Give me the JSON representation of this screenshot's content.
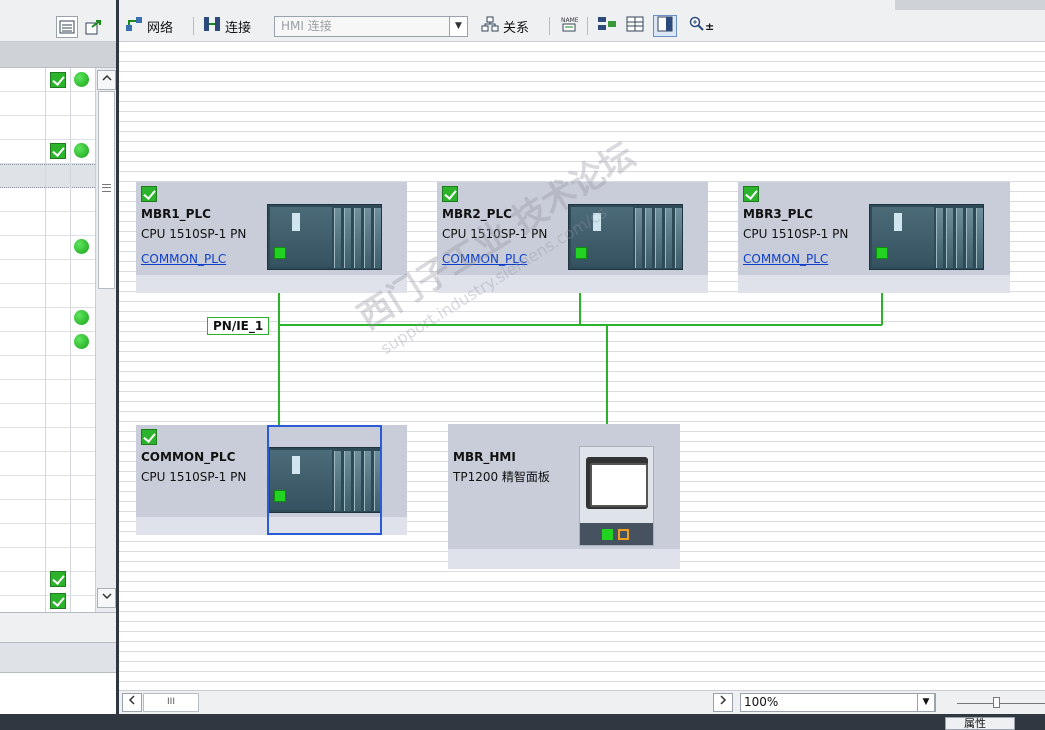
{
  "toolbar": {
    "network_label": "网络",
    "connections_label": "连接",
    "connection_type_value": "HMI 连接",
    "relations_label": "关系",
    "zoom_label": "±"
  },
  "devices": [
    {
      "id": "mbr1",
      "name": "MBR1_PLC",
      "type": "CPU 1510SP-1 PN",
      "link": "COMMON_PLC"
    },
    {
      "id": "mbr2",
      "name": "MBR2_PLC",
      "type": "CPU 1510SP-1 PN",
      "link": "COMMON_PLC"
    },
    {
      "id": "mbr3",
      "name": "MBR3_PLC",
      "type": "CPU 1510SP-1 PN",
      "link": "COMMON_PLC"
    },
    {
      "id": "common",
      "name": "COMMON_PLC",
      "type": "CPU 1510SP-1 PN",
      "link": ""
    },
    {
      "id": "hmi",
      "name": "MBR_HMI",
      "type": "TP1200 精智面板",
      "link": ""
    }
  ],
  "network": {
    "subnet_label": "PN/IE_1"
  },
  "watermark": {
    "line1": "西门子工业 技术论坛",
    "line2": "support.industry.siemens.com/cs"
  },
  "bottom": {
    "zoom_value": "100%",
    "zoom_slider_fraction": 0.45,
    "scroll_grip": "III"
  },
  "statusbar": {
    "properties_tab": "属性"
  },
  "colors": {
    "accent_green": "#2bb32b",
    "link_blue": "#1040c8",
    "selection_blue": "#2b5bd6"
  }
}
